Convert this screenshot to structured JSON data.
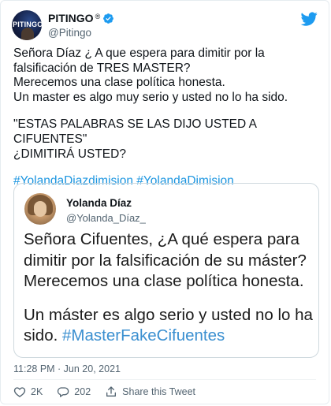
{
  "author": {
    "display_name": "PITINGO",
    "registered_mark": "®",
    "handle": "@Pitingo",
    "avatar_text": "PITINGO"
  },
  "tweet": {
    "line1": "Señora Díaz ¿ A que espera para dimitir por la falsificación de TRES  MASTER?",
    "line2": "Merecemos una clase política honesta.",
    "line3": "Un master es algo muy serio y usted no lo ha sido.",
    "line4": "\"ESTAS PALABRAS SE LAS DIJO USTED A CIFUENTES\"",
    "line5": "¿DIMITIRÁ USTED?",
    "hashtag1": "#YolandaDiazdimision",
    "hashtag2": "#YolandaDimision"
  },
  "quoted": {
    "display_name": "Yolanda Díaz",
    "handle": "@Yolanda_Díaz_",
    "p1": "Señora Cifuentes, ¿A qué espera para dimitir por la falsificación de su máster? Merecemos una clase política honesta.",
    "p2_text": "Un máster es algo serio y usted no lo ha sido.",
    "p2_hashtag": "#MasterFakeCifuentes"
  },
  "meta": {
    "timestamp": "11:28 PM · Jun 20, 2021"
  },
  "actions": {
    "likes": "2K",
    "replies": "202",
    "share_label": "Share this Tweet"
  },
  "colors": {
    "link": "#1b95e0",
    "verified": "#1d9bf0",
    "twitter_brand": "#1d9bf0"
  },
  "icons": [
    "verified-badge-icon",
    "twitter-bird-icon",
    "heart-icon",
    "reply-icon",
    "share-icon"
  ]
}
